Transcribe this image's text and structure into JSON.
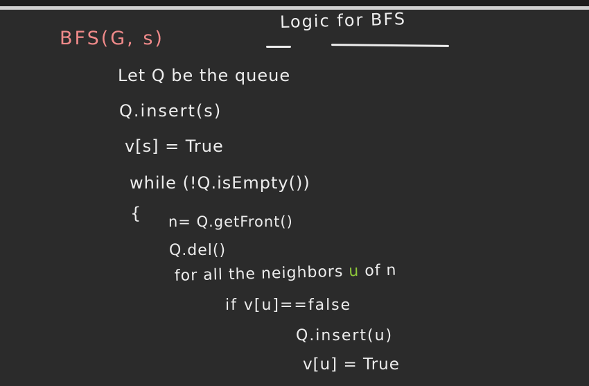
{
  "title": "Logic for BFS",
  "signature": "BFS(G, s)",
  "lines": {
    "l1": "Let Q be the queue",
    "l2": "Q.insert(s)",
    "l3": "v[s] = True",
    "l4": "while (!Q.isEmpty())",
    "l5": "{",
    "l6": "n= Q.getFront()",
    "l7": "Q.del()",
    "l8_pre": "for all the neighbors ",
    "l8_var": "u",
    "l8_post": " of n",
    "l9": "if v[u]==false",
    "l10": "Q.insert(u)",
    "l11": "v[u] = True"
  },
  "colors": {
    "background": "#2b2b2b",
    "chalk": "#ededed",
    "signature": "#f08a8a",
    "accent": "#8fc93a"
  }
}
